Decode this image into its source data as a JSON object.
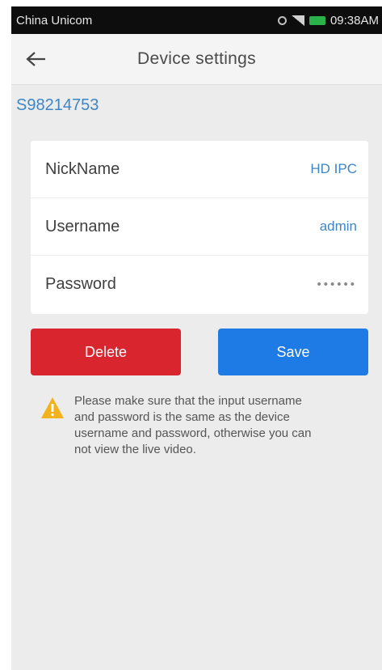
{
  "status_bar": {
    "carrier": "China Unicom",
    "time": "09:38AM",
    "icons": [
      "alarm-icon",
      "signal-icon",
      "battery-icon"
    ],
    "battery_color": "#29b24a"
  },
  "header": {
    "title": "Device settings",
    "back_icon": "arrow-left-icon"
  },
  "device": {
    "id": "S98214753"
  },
  "fields": [
    {
      "label": "NickName",
      "value": "HD IPC"
    },
    {
      "label": "Username",
      "value": "admin"
    },
    {
      "label": "Password",
      "value": "••••••"
    }
  ],
  "actions": {
    "delete_label": "Delete",
    "save_label": "Save",
    "delete_color": "#d9262e",
    "save_color": "#1e7be6"
  },
  "warning": {
    "icon": "warning-triangle-icon",
    "text": "Please make sure that the input username and password is the same as the device username and password, otherwise you can not view the live video."
  },
  "colors": {
    "accent": "#3d86c6",
    "background": "#ececec"
  }
}
